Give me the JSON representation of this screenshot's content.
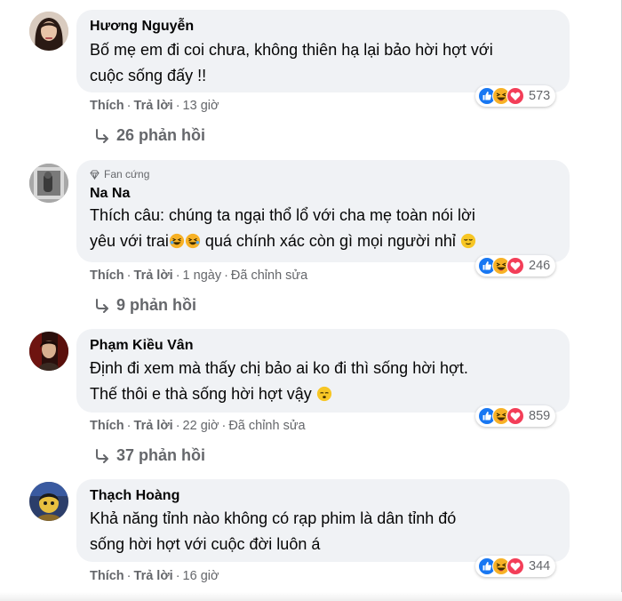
{
  "comments": [
    {
      "author": "Hương Nguyễn",
      "badge": "",
      "text": "Bố mẹ em đi coi chưa, không thiên hạ lại bảo hời hợt với\ncuộc sống đấy !!",
      "like_label": "Thích",
      "reply_label": "Trả lời",
      "time": "13 giờ",
      "edited": "",
      "reaction_count": "573",
      "replies": "26 phản hồi",
      "avatar_icon": "avatar-woman-dark-hair"
    },
    {
      "author": "Na Na",
      "badge": "Fan cứng",
      "text_before": "Thích câu: chúng ta ngại thổ lổ với cha mẹ toàn nói lời\nyêu với trai",
      "text_after": " quá chính xác còn gì mọi người nhỉ",
      "like_label": "Thích",
      "reply_label": "Trả lời",
      "time": "1 ngày",
      "edited": "Đã chỉnh sửa",
      "reaction_count": "246",
      "replies": "9 phản hồi",
      "avatar_icon": "avatar-window-photo"
    },
    {
      "author": "Phạm Kiều Vân",
      "badge": "",
      "text": "Định đi xem mà thấy chị bảo ai ko đi thì sống hời hợt.\nThế thôi e thà sống hời hợt vậy",
      "like_label": "Thích",
      "reply_label": "Trả lời",
      "time": "22 giờ",
      "edited": "Đã chỉnh sửa",
      "reaction_count": "859",
      "replies": "37 phản hồi",
      "avatar_icon": "avatar-dark-red-photo"
    },
    {
      "author": "Thạch Hoàng",
      "badge": "",
      "text": "Khả năng tỉnh nào không có rạp phim là dân tỉnh đó\nsống hời hợt với cuộc đời luôn á",
      "like_label": "Thích",
      "reply_label": "Trả lời",
      "time": "16 giờ",
      "edited": "",
      "reaction_count": "344",
      "replies": "",
      "avatar_icon": "avatar-cartoon-character"
    }
  ],
  "separator": "·",
  "reply_arrow_icon": "reply-arrow-icon",
  "reaction_icons": [
    "like-reaction-icon",
    "haha-reaction-icon",
    "love-reaction-icon"
  ],
  "colors": {
    "bubble": "#f0f2f5",
    "meta_text": "#65676b",
    "like_blue": "#1877f2",
    "love_red": "#f33e58",
    "haha_yellow": "#f7b125"
  }
}
